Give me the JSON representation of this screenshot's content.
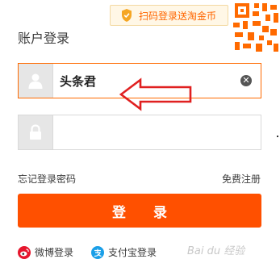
{
  "promo": {
    "text": "扫码登录送淘金币",
    "icon": "shield-icon"
  },
  "title": "账户登录",
  "username": {
    "value": "头条君",
    "icon": "user-icon",
    "clear_icon": "clear-icon"
  },
  "password": {
    "value": "",
    "icon": "lock-icon"
  },
  "links": {
    "forgot": "忘记登录密码",
    "register": "免费注册"
  },
  "login_button": "登 录",
  "social": {
    "weibo": "微博登录",
    "alipay": "支付宝登录"
  },
  "watermark": "Bai du 经验",
  "colors": {
    "accent": "#ff5000",
    "annotation_arrow": "#e02020",
    "promo_text": "#ff6600"
  }
}
